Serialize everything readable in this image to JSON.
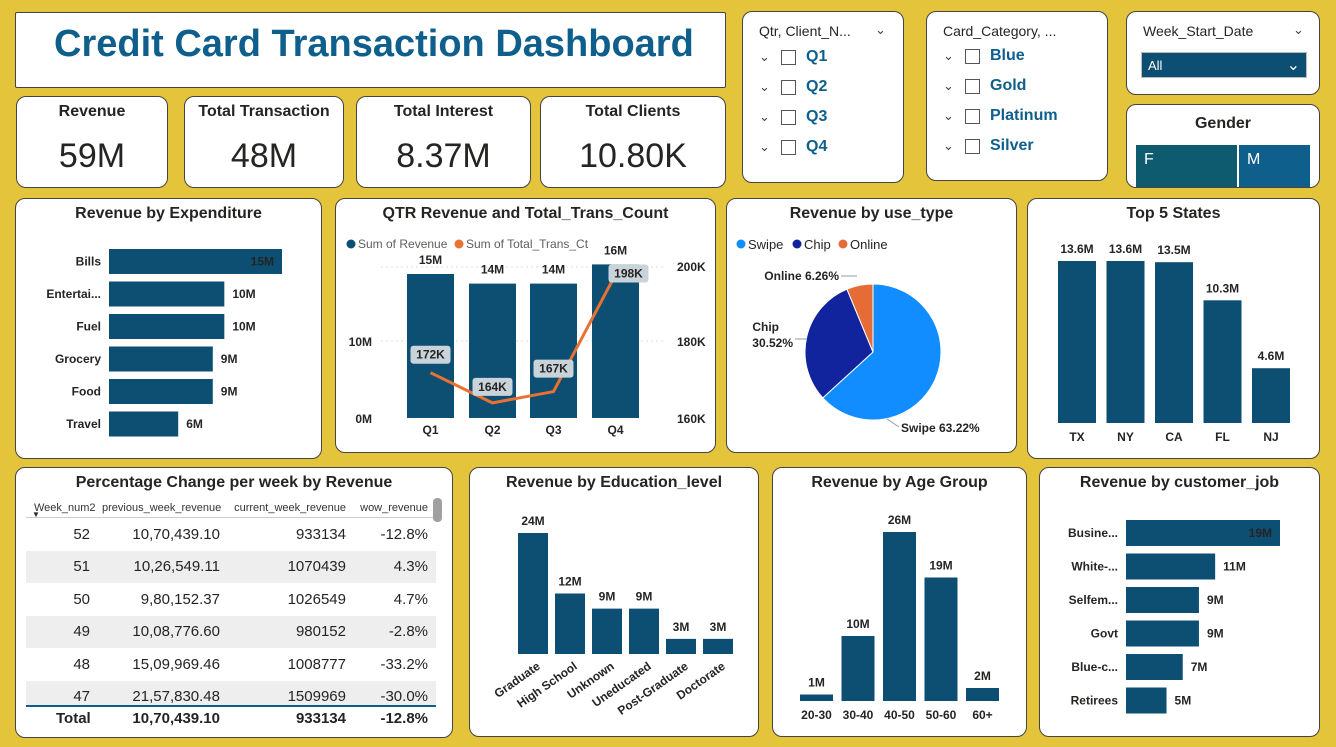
{
  "header": {
    "title": "Credit Card Transaction Dashboard"
  },
  "kpis": [
    {
      "label": "Revenue",
      "value": "59M"
    },
    {
      "label": "Total Transaction",
      "value": "48M"
    },
    {
      "label": "Total Interest",
      "value": "8.37M"
    },
    {
      "label": "Total Clients",
      "value": "10.80K"
    }
  ],
  "slicers": {
    "qtr": {
      "header": "Qtr, Client_N...",
      "items": [
        "Q1",
        "Q2",
        "Q3",
        "Q4"
      ]
    },
    "card_category": {
      "header": "Card_Category, ...",
      "items": [
        "Blue",
        "Gold",
        "Platinum",
        "Silver"
      ]
    },
    "week_start": {
      "header": "Week_Start_Date",
      "selected": "All"
    },
    "gender": {
      "title": "Gender",
      "options": [
        "F",
        "M"
      ]
    }
  },
  "icons": {
    "chevron_down": "chevron-down-icon",
    "checkbox": "checkbox-icon",
    "sort": "sort-desc-icon"
  },
  "colors": {
    "bar": "#0c4f73",
    "line": "#e97132",
    "swipe": "#118dff",
    "chip": "#12239e",
    "online": "#e66c37",
    "background": "#e3c43b",
    "title": "#0f5f8c"
  },
  "charts": {
    "expenditure": {
      "title": "Revenue by Expenditure",
      "chart_data": {
        "type": "bar",
        "orientation": "horizontal",
        "categories": [
          "Bills",
          "Entertai...",
          "Fuel",
          "Grocery",
          "Food",
          "Travel"
        ],
        "values": [
          15,
          10,
          10,
          9,
          9,
          6
        ],
        "labels": [
          "15M",
          "10M",
          "10M",
          "9M",
          "9M",
          "6M"
        ]
      }
    },
    "qtr": {
      "title": "QTR Revenue and Total_Trans_Count",
      "legend": [
        "Sum of Revenue",
        "Sum of Total_Trans_Ct"
      ],
      "chart_data": {
        "type": "bar",
        "categories": [
          "Q1",
          "Q2",
          "Q3",
          "Q4"
        ],
        "series": [
          {
            "name": "Sum of Revenue",
            "values": [
              15,
              14,
              14,
              16
            ],
            "labels": [
              "15M",
              "14M",
              "14M",
              "16M"
            ]
          },
          {
            "name": "Sum of Total_Trans_Ct",
            "values": [
              172,
              164,
              167,
              198
            ],
            "labels": [
              "172K",
              "164K",
              "167K",
              "198K"
            ]
          }
        ],
        "y_ticks": [
          "0M",
          "10M"
        ],
        "y2_ticks": [
          "160K",
          "180K",
          "200K"
        ],
        "ylim": [
          0,
          17.5
        ],
        "y2lim": [
          160,
          200
        ]
      }
    },
    "use_type": {
      "title": "Revenue by use_type",
      "legend": [
        "Swipe",
        "Chip",
        "Online"
      ],
      "chart_data": {
        "type": "pie",
        "categories": [
          "Swipe",
          "Chip",
          "Online"
        ],
        "values": [
          63.22,
          30.52,
          6.26
        ],
        "labels": [
          "Swipe 63.22%",
          "Chip\n30.52%",
          "Online 6.26%"
        ]
      }
    },
    "states": {
      "title": "Top 5 States",
      "chart_data": {
        "type": "bar",
        "categories": [
          "TX",
          "NY",
          "CA",
          "FL",
          "NJ"
        ],
        "values": [
          13.6,
          13.6,
          13.5,
          10.3,
          4.6
        ],
        "labels": [
          "13.6M",
          "13.6M",
          "13.5M",
          "10.3M",
          "4.6M"
        ]
      }
    },
    "education": {
      "title": "Revenue by Education_level",
      "chart_data": {
        "type": "bar",
        "categories": [
          "Graduate",
          "High School",
          "Unknown",
          "Uneducated",
          "Post-Graduate",
          "Doctorate"
        ],
        "values": [
          24,
          12,
          9,
          9,
          3,
          3
        ],
        "labels": [
          "24M",
          "12M",
          "9M",
          "9M",
          "3M",
          "3M"
        ]
      }
    },
    "age": {
      "title": "Revenue by Age Group",
      "chart_data": {
        "type": "bar",
        "categories": [
          "20-30",
          "30-40",
          "40-50",
          "50-60",
          "60+"
        ],
        "values": [
          1,
          10,
          26,
          19,
          2
        ],
        "labels": [
          "1M",
          "10M",
          "26M",
          "19M",
          "2M"
        ]
      }
    },
    "job": {
      "title": "Revenue by customer_job",
      "chart_data": {
        "type": "bar",
        "orientation": "horizontal",
        "categories": [
          "Busine...",
          "White-...",
          "Selfem...",
          "Govt",
          "Blue-c...",
          "Retirees"
        ],
        "values": [
          19,
          11,
          9,
          9,
          7,
          5
        ],
        "labels": [
          "19M",
          "11M",
          "9M",
          "9M",
          "7M",
          "5M"
        ]
      }
    }
  },
  "wow_table": {
    "title": "Percentage Change per week by Revenue",
    "columns": [
      "Week_num2",
      "previous_week_revenue",
      "current_week_revenue",
      "wow_revenue"
    ],
    "rows": [
      [
        "52",
        "10,70,439.10",
        "933134",
        "-12.8%"
      ],
      [
        "51",
        "10,26,549.11",
        "1070439",
        "4.3%"
      ],
      [
        "50",
        "9,80,152.37",
        "1026549",
        "4.7%"
      ],
      [
        "49",
        "10,08,776.60",
        "980152",
        "-2.8%"
      ],
      [
        "48",
        "15,09,969.46",
        "1008777",
        "-33.2%"
      ],
      [
        "47",
        "21,57,830.48",
        "1509969",
        "-30.0%"
      ]
    ],
    "total": [
      "Total",
      "10,70,439.10",
      "933134",
      "-12.8%"
    ]
  }
}
